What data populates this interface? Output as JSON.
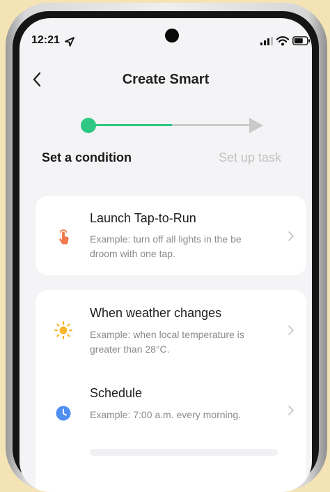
{
  "status_bar": {
    "time": "12:21"
  },
  "nav": {
    "title": "Create Smart"
  },
  "stepper": {
    "step1_label": "Set a condition",
    "step2_label": "Set up task",
    "active_color": "#2ec784",
    "inactive_color": "#c9c9c9",
    "inactive_text_color": "#c2c2c2"
  },
  "options": [
    {
      "title": "Launch Tap-to-Run",
      "description": "Example: turn off all lights in the be droom with one tap.",
      "icon": "tap-hand-icon",
      "icon_color": "#f07a4b"
    },
    {
      "title": "When weather changes",
      "description": "Example: when local temperature is greater than 28°C.",
      "icon": "sun-icon",
      "icon_color": "#f8b62a"
    },
    {
      "title": "Schedule",
      "description": "Example: 7:00 a.m. every morning.",
      "icon": "clock-icon",
      "icon_color": "#4f8ff0"
    }
  ]
}
